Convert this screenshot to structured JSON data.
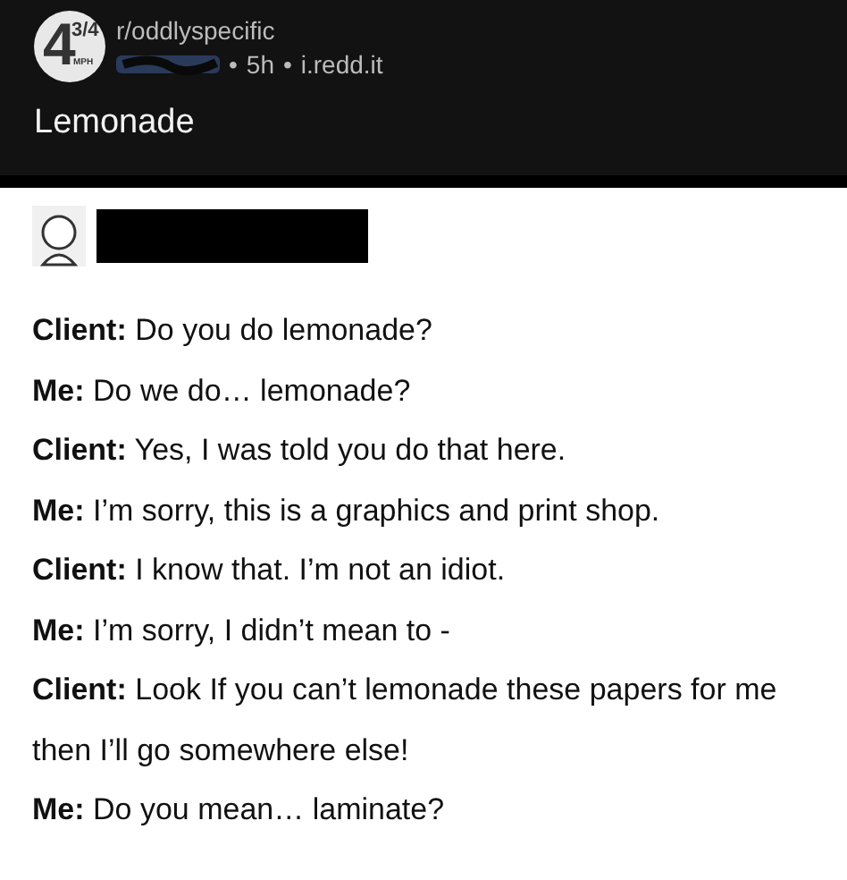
{
  "post": {
    "community_icon": {
      "number": "4",
      "fraction": "3/4",
      "unit": "MPH"
    },
    "subreddit": "r/oddlyspecific",
    "separators": [
      "•",
      "•"
    ],
    "age": "5h",
    "domain": "i.redd.it",
    "title": "Lemonade"
  },
  "image": {
    "lines": [
      {
        "speaker": "Client:",
        "text": "Do you do lemonade?"
      },
      {
        "speaker": "Me:",
        "text": "Do we do… lemonade?"
      },
      {
        "speaker": "Client:",
        "text": "Yes, I was told you do that here."
      },
      {
        "speaker": "Me:",
        "text": "I’m sorry, this is a graphics and print shop."
      },
      {
        "speaker": "Client:",
        "text": "I know that. I’m not an idiot."
      },
      {
        "speaker": "Me:",
        "text": "I’m sorry, I didn’t mean to -"
      },
      {
        "speaker": "Client:",
        "text": "Look If you can’t lemonade these papers for me then I’ll go somewhere else!"
      },
      {
        "speaker": "Me:",
        "text": "Do you mean… laminate?"
      }
    ]
  }
}
